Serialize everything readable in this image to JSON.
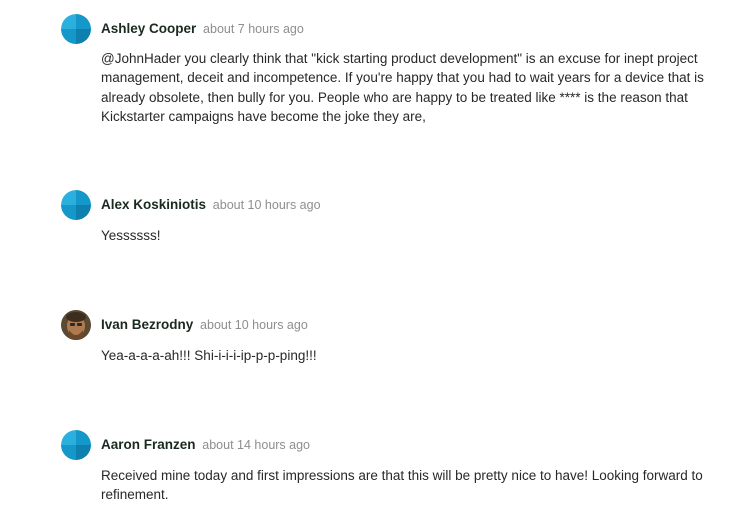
{
  "comments": [
    {
      "author": "Ashley Cooper",
      "time": "about 7 hours ago",
      "avatar": "default-avatar-icon",
      "text": "@JohnHader you clearly think that \"kick starting product development\" is an excuse for inept project management, deceit and incompetence. If you're happy that you had to wait years for a device that is already obsolete, then bully for you. People who are happy to be treated like **** is the reason that Kickstarter campaigns have become the joke they are,"
    },
    {
      "author": "Alex Koskiniotis",
      "time": "about 10 hours ago",
      "avatar": "default-avatar-icon",
      "text": "Yessssss!"
    },
    {
      "author": "Ivan Bezrodny",
      "time": "about 10 hours ago",
      "avatar": "user-photo-avatar",
      "text": "Yea-a-a-a-ah!!! Shi-i-i-i-ip-p-p-ping!!!"
    },
    {
      "author": "Aaron Franzen",
      "time": "about 14 hours ago",
      "avatar": "default-avatar-icon",
      "text": "Received mine today and first impressions are that this will be pretty nice to have! Looking forward to refinement."
    }
  ],
  "colors": {
    "author": "#1b2a1f",
    "timestamp": "#8e8e8e",
    "body_text": "#282828",
    "avatar_light": "#2bb0de",
    "avatar_dark": "#0e7fae"
  }
}
